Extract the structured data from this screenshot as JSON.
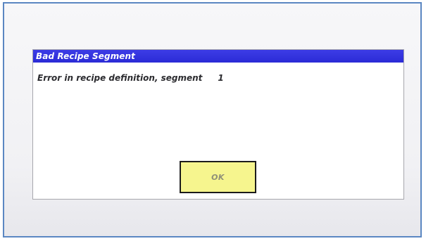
{
  "dialog": {
    "title": "Bad Recipe Segment",
    "message": "Error in recipe definition, segment",
    "segment_number": "1",
    "ok_label": "OK"
  },
  "colors": {
    "frame_border": "#5b87c2",
    "titlebar": "#2b2bd6",
    "ok_button": "#f6f58e"
  }
}
